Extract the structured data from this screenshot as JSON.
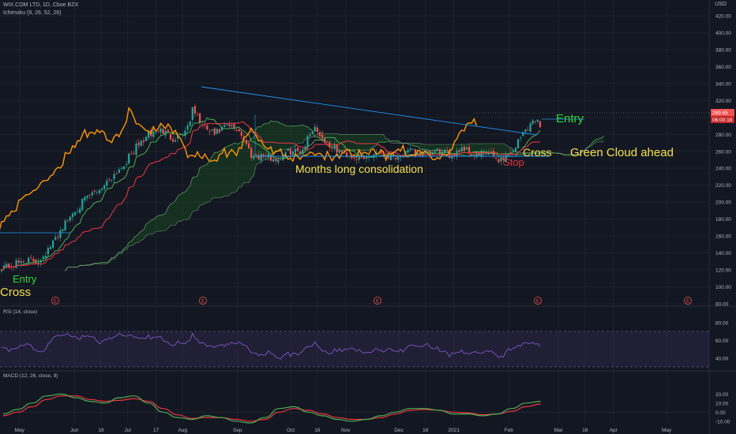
{
  "header": {
    "title": "WIX.COM LTD, 1D, Cboe BZX",
    "indicator": "Ichimoku (9, 26, 52, 26)",
    "currency": "USD"
  },
  "price_tags": {
    "last": "289.65",
    "countdown": "06:00:16"
  },
  "colors": {
    "background": "#131722",
    "grid": "#1e222d",
    "candle_up": "#26a69a",
    "candle_down": "#ef5350",
    "tenkan": "#4caf50",
    "kijun": "#f23645",
    "chikou": "#ff9800",
    "cloud_bull": "#1b5e20",
    "trendline": "#2196f3",
    "rsi": "#7e57c2",
    "macd": "#4caf50",
    "signal": "#f23645",
    "text_yellow": "#f5e050",
    "text_green": "#36d436",
    "text_red": "#e8323c"
  },
  "annotations": [
    {
      "key": "entry_left",
      "text": "Entry",
      "color": "green"
    },
    {
      "key": "cross_left",
      "text": "Cross",
      "color": "yellow"
    },
    {
      "key": "consolidation",
      "text": "Months long consolidation",
      "color": "yellow"
    },
    {
      "key": "stop",
      "text": "Stop",
      "color": "red"
    },
    {
      "key": "cross_right",
      "text": "Cross",
      "color": "yellow"
    },
    {
      "key": "entry_right",
      "text": "Entry",
      "color": "green"
    },
    {
      "key": "green_cloud",
      "text": "Green Cloud ahead",
      "color": "yellow"
    }
  ],
  "earnings_marker": "E",
  "chart_data": [
    {
      "type": "candlestick",
      "ticker": "WIX.COM LTD",
      "x_axis_labels": [
        "May",
        "Jun",
        "16",
        "Jul",
        "17",
        "Aug",
        "Sep",
        "Oct",
        "16",
        "Nov",
        "Dec",
        "16",
        "2021",
        "Feb",
        "Mar",
        "16",
        "Apr",
        "May"
      ],
      "y_ticks": [
        80,
        100,
        120,
        140,
        160,
        180,
        200,
        220,
        240,
        260,
        280,
        300,
        320,
        340,
        360,
        380,
        400,
        420
      ],
      "ylim": [
        80,
        420
      ],
      "price_path": [
        {
          "date": "2020-04-27",
          "close": 125
        },
        {
          "date": "2020-05-04",
          "close": 132
        },
        {
          "date": "2020-05-11",
          "close": 130
        },
        {
          "date": "2020-05-18",
          "close": 145
        },
        {
          "date": "2020-05-25",
          "close": 170
        },
        {
          "date": "2020-06-01",
          "close": 190
        },
        {
          "date": "2020-06-08",
          "close": 205
        },
        {
          "date": "2020-06-15",
          "close": 215
        },
        {
          "date": "2020-06-22",
          "close": 230
        },
        {
          "date": "2020-06-29",
          "close": 245
        },
        {
          "date": "2020-07-06",
          "close": 265
        },
        {
          "date": "2020-07-13",
          "close": 280
        },
        {
          "date": "2020-07-20",
          "close": 285
        },
        {
          "date": "2020-07-27",
          "close": 275
        },
        {
          "date": "2020-08-03",
          "close": 285
        },
        {
          "date": "2020-08-07",
          "close": 310
        },
        {
          "date": "2020-08-12",
          "close": 290
        },
        {
          "date": "2020-08-19",
          "close": 280
        },
        {
          "date": "2020-08-26",
          "close": 290
        },
        {
          "date": "2020-09-02",
          "close": 285
        },
        {
          "date": "2020-09-09",
          "close": 255
        },
        {
          "date": "2020-09-16",
          "close": 255
        },
        {
          "date": "2020-09-23",
          "close": 250
        },
        {
          "date": "2020-09-30",
          "close": 260
        },
        {
          "date": "2020-10-07",
          "close": 260
        },
        {
          "date": "2020-10-14",
          "close": 290
        },
        {
          "date": "2020-10-21",
          "close": 270
        },
        {
          "date": "2020-10-28",
          "close": 260
        },
        {
          "date": "2020-11-04",
          "close": 255
        },
        {
          "date": "2020-11-11",
          "close": 250
        },
        {
          "date": "2020-11-18",
          "close": 260
        },
        {
          "date": "2020-11-25",
          "close": 255
        },
        {
          "date": "2020-12-02",
          "close": 255
        },
        {
          "date": "2020-12-09",
          "close": 260
        },
        {
          "date": "2020-12-16",
          "close": 255
        },
        {
          "date": "2020-12-23",
          "close": 260
        },
        {
          "date": "2020-12-30",
          "close": 255
        },
        {
          "date": "2021-01-06",
          "close": 265
        },
        {
          "date": "2021-01-13",
          "close": 255
        },
        {
          "date": "2021-01-20",
          "close": 258
        },
        {
          "date": "2021-01-27",
          "close": 250
        },
        {
          "date": "2021-02-03",
          "close": 260
        },
        {
          "date": "2021-02-10",
          "close": 285
        },
        {
          "date": "2021-02-16",
          "close": 298
        },
        {
          "date": "2021-02-19",
          "close": 290
        }
      ],
      "series": [
        {
          "name": "Ichimoku (9, 26, 52, 26)"
        }
      ]
    },
    {
      "type": "line",
      "title": "RSI (14, close)",
      "y_ticks": [
        40,
        60,
        80
      ],
      "ylim": [
        25,
        95
      ],
      "bands": [
        30,
        70
      ]
    },
    {
      "type": "line",
      "title": "MACD (12, 26, close, 9)",
      "y_ticks": [
        -10,
        0,
        10,
        20
      ],
      "ylim": [
        -16,
        28
      ],
      "series": [
        {
          "values": [
            -2,
            3,
            10,
            18,
            20,
            16,
            12,
            10,
            16,
            18,
            10,
            0,
            -6,
            -8,
            -4,
            -6,
            -10,
            -12,
            -6,
            4,
            6,
            0,
            -4,
            -8,
            -10,
            -8,
            -4,
            0,
            4,
            4,
            2,
            -2,
            -2,
            -4,
            -2,
            4,
            10,
            12
          ]
        },
        {
          "values": [
            -4,
            0,
            6,
            14,
            18,
            18,
            14,
            12,
            13,
            15,
            12,
            4,
            -3,
            -7,
            -6,
            -6,
            -8,
            -10,
            -8,
            0,
            4,
            2,
            -2,
            -6,
            -8,
            -8,
            -6,
            -2,
            2,
            3,
            2,
            0,
            -1,
            -3,
            -2,
            1,
            6,
            9
          ]
        }
      ]
    }
  ]
}
